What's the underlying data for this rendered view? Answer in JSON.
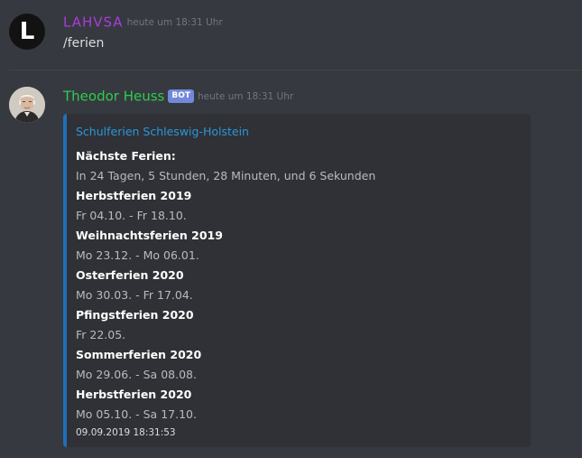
{
  "messages": [
    {
      "username": "LAHVSA",
      "timestamp": "heute um 18:31 Uhr",
      "content": "/ferien",
      "avatar_letter": "L"
    },
    {
      "username": "Theodor Heuss",
      "badge": "BOT",
      "timestamp": "heute um 18:31 Uhr"
    }
  ],
  "embed": {
    "title": "Schulferien Schleswig-Holstein",
    "accent_color": "#1f6fb8",
    "fields": [
      {
        "name": "Nächste Ferien:",
        "value": "In 24 Tagen, 5 Stunden, 28 Minuten, und 6 Sekunden"
      },
      {
        "name": "Herbstferien 2019",
        "value": "Fr 04.10. - Fr 18.10."
      },
      {
        "name": "Weihnachtsferien 2019",
        "value": "Mo 23.12. - Mo 06.01."
      },
      {
        "name": "Osterferien 2020",
        "value": "Mo 30.03. - Fr 17.04."
      },
      {
        "name": "Pfingstferien 2020",
        "value": "Fr 22.05."
      },
      {
        "name": "Sommerferien 2020",
        "value": "Mo 29.06. - Sa 08.08."
      },
      {
        "name": "Herbstferien 2020",
        "value": "Mo 05.10. - Sa 17.10."
      }
    ],
    "footer": "09.09.2019 18:31:53"
  },
  "colors": {
    "background": "#36393f",
    "embed_background": "#2f3136",
    "username_lahvsa": "#a93ddc",
    "username_theodor": "#2ecc4f",
    "bot_badge": "#7289da",
    "link": "#2a97d8"
  }
}
